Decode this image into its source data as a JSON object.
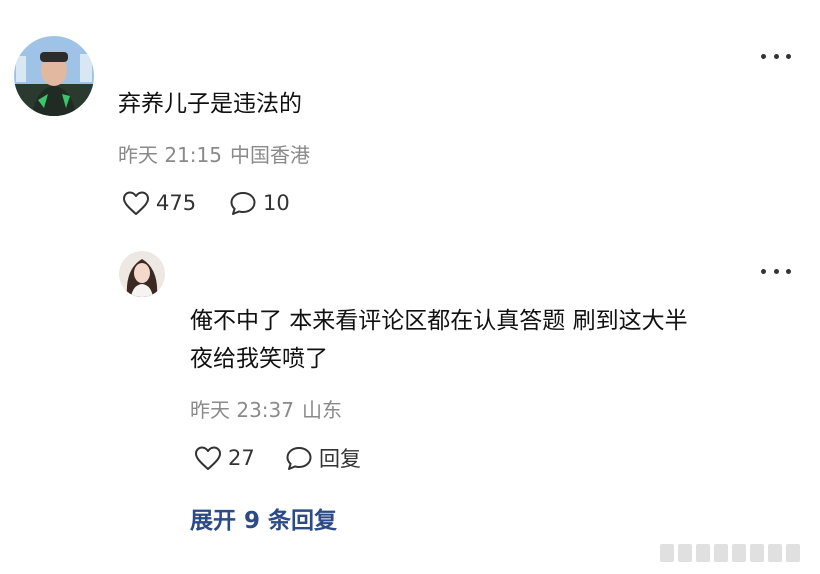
{
  "comment": {
    "text": "弃养儿子是违法的",
    "time": "昨天 21:15",
    "location": "中国香港",
    "likes": "475",
    "replies": "10"
  },
  "reply": {
    "text_line1": "俺不中了 本来看评论区都在认真答题 刷到这大半",
    "text_line2": "夜给我笑喷了",
    "time": "昨天 23:37",
    "location": "山东",
    "likes": "27",
    "reply_label": "回复"
  },
  "expand_label": "展开 9 条回复",
  "icons": {
    "more": "more-dots-icon",
    "like": "heart-outline-icon",
    "comment": "speech-bubble-icon"
  },
  "colors": {
    "link": "#2b4a86",
    "meta": "#8a8a8a",
    "text": "#111111"
  }
}
